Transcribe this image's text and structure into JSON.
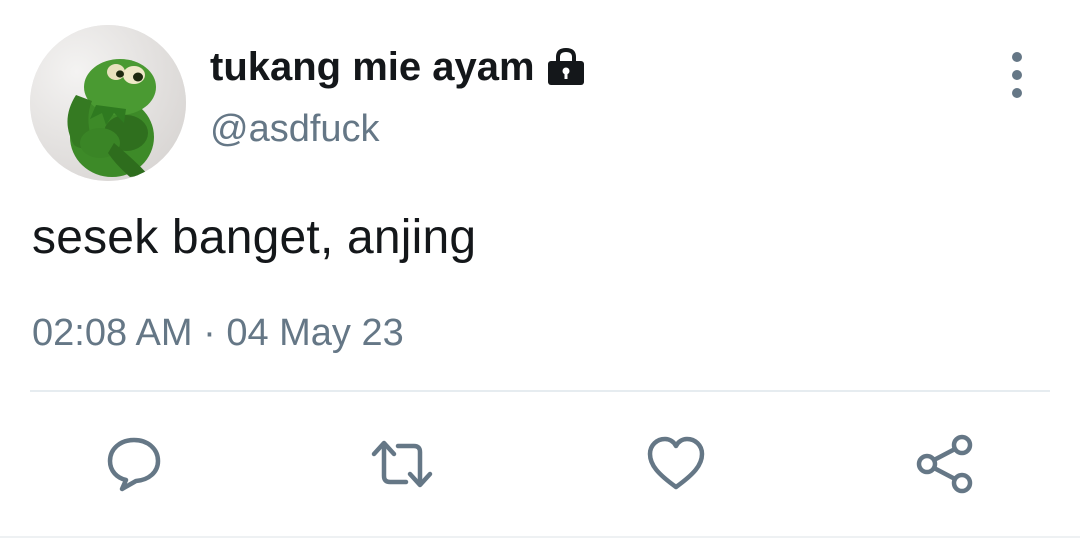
{
  "tweet": {
    "display_name": "tukang mie ayam",
    "handle": "@asdfuck",
    "text": "sesek banget, anjing",
    "timestamp": "02:08 AM · 04 May 23",
    "protected_icon": "lock-icon",
    "more_icon": "more-vertical-icon"
  },
  "actions": [
    {
      "name": "reply",
      "icon": "comment-bubble-icon"
    },
    {
      "name": "retweet",
      "icon": "retweet-icon"
    },
    {
      "name": "like",
      "icon": "heart-icon"
    },
    {
      "name": "share",
      "icon": "share-icon"
    }
  ],
  "colors": {
    "text_primary": "#14171a",
    "text_secondary": "#657786",
    "divider": "#e6ecf0",
    "avatar_green": "#3f8a2a"
  }
}
